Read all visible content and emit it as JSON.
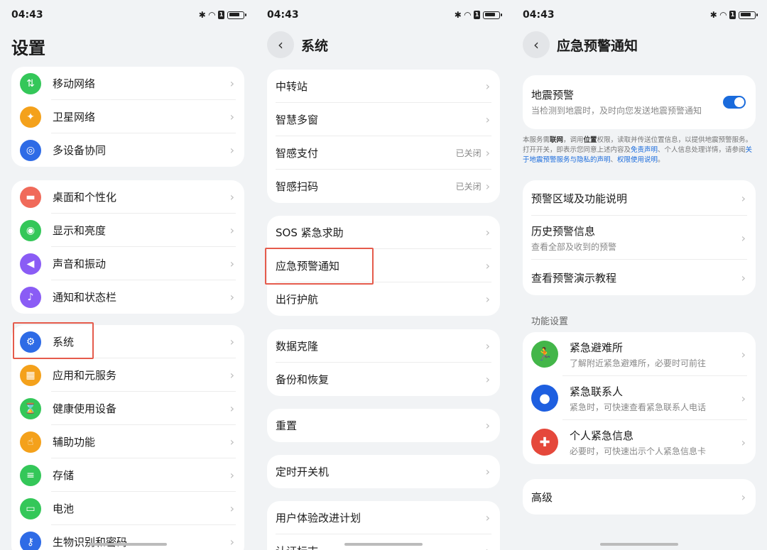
{
  "status": {
    "time": "04:43",
    "sim_label": "1"
  },
  "left": {
    "title": "设置",
    "group1": [
      {
        "label": "移动网络",
        "icon": "mobile-data-icon",
        "color": "#34c759"
      },
      {
        "label": "卫星网络",
        "icon": "satellite-icon",
        "color": "#f4a11b"
      },
      {
        "label": "多设备协同",
        "icon": "multi-device-icon",
        "color": "#2e6be6"
      }
    ],
    "group2": [
      {
        "label": "桌面和个性化",
        "icon": "paint-brush-icon",
        "color": "#f06a5a"
      },
      {
        "label": "显示和亮度",
        "icon": "eye-icon",
        "color": "#34c759"
      },
      {
        "label": "声音和振动",
        "icon": "speaker-icon",
        "color": "#8a5cf5"
      },
      {
        "label": "通知和状态栏",
        "icon": "bell-icon",
        "color": "#8a5cf5"
      }
    ],
    "group3": [
      {
        "label": "系统",
        "icon": "gear-icon",
        "color": "#2e6be6"
      },
      {
        "label": "应用和元服务",
        "icon": "apps-grid-icon",
        "color": "#f4a11b"
      },
      {
        "label": "健康使用设备",
        "icon": "hourglass-icon",
        "color": "#34c759"
      },
      {
        "label": "辅助功能",
        "icon": "hand-icon",
        "color": "#f4a11b"
      },
      {
        "label": "存储",
        "icon": "storage-icon",
        "color": "#34c759"
      },
      {
        "label": "电池",
        "icon": "battery-icon",
        "color": "#34c759"
      },
      {
        "label": "生物识别和密码",
        "icon": "key-icon",
        "color": "#2e6be6"
      }
    ]
  },
  "middle": {
    "title": "系统",
    "group1": [
      {
        "label": "中转站",
        "value": ""
      },
      {
        "label": "智慧多窗",
        "value": ""
      },
      {
        "label": "智感支付",
        "value": "已关闭"
      },
      {
        "label": "智感扫码",
        "value": "已关闭"
      }
    ],
    "group2": [
      {
        "label": "SOS 紧急求助"
      },
      {
        "label": "应急预警通知"
      },
      {
        "label": "出行护航"
      }
    ],
    "group3": [
      {
        "label": "数据克隆"
      },
      {
        "label": "备份和恢复"
      }
    ],
    "group4": [
      {
        "label": "重置"
      }
    ],
    "group5": [
      {
        "label": "定时开关机"
      }
    ],
    "group6": [
      {
        "label": "用户体验改进计划"
      },
      {
        "label": "认证标志"
      }
    ]
  },
  "right": {
    "title": "应急预警通知",
    "quake": {
      "label": "地震预警",
      "sub": "当检测到地震时，及时向您发送地震预警通知",
      "toggle_on": true
    },
    "notice": {
      "p1": "本服务需",
      "b1": "联网",
      "p2": "，调用",
      "b2": "位置",
      "p3": "权限，读取并传送位置信息，以提供地震预警服务。打开开关，即表示您同意上述内容及",
      "l1": "免责声明",
      "p4": "、个人信息处理详情，请参阅",
      "l2": "关于地震预警服务与隐私的声明",
      "p5": "、",
      "l3": "权限使用说明",
      "p6": "。"
    },
    "group1": [
      {
        "label": "预警区域及功能说明",
        "sub": ""
      },
      {
        "label": "历史预警信息",
        "sub": "查看全部及收到的预警"
      },
      {
        "label": "查看预警演示教程",
        "sub": ""
      }
    ],
    "section_label": "功能设置",
    "group2": [
      {
        "label": "紧急避难所",
        "sub": "了解附近紧急避难所，必要时可前往",
        "icon": "running-person-icon",
        "color": "#43b649"
      },
      {
        "label": "紧急联系人",
        "sub": "紧急时，可快速查看紧急联系人电话",
        "icon": "person-icon",
        "color": "#1e5fe0"
      },
      {
        "label": "个人紧急信息",
        "sub": "必要时，可快速出示个人紧急信息卡",
        "icon": "medical-cross-icon",
        "color": "#e5483b"
      }
    ],
    "group3": [
      {
        "label": "高级"
      }
    ]
  }
}
